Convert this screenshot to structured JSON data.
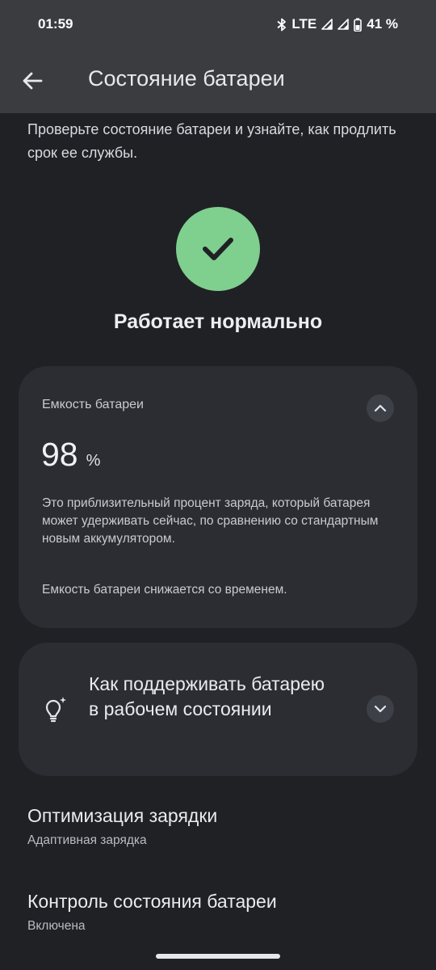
{
  "status_bar": {
    "time": "01:59",
    "network": "LTE",
    "battery_percent": "41 %"
  },
  "app_bar": {
    "title": "Состояние батареи"
  },
  "description": "Проверьте состояние батареи и узнайте, как продлить срок ее службы.",
  "health": {
    "status": "Работает нормально",
    "status_color": "#7fcf8f"
  },
  "capacity_card": {
    "label": "Емкость батареи",
    "value": "98",
    "unit": "%",
    "text": "Это приблизительный процент заряда, который батарея может удерживать сейчас, по сравнению со стандартным новым аккумулятором.",
    "note": "Емкость батареи снижается со временем.",
    "expanded": true
  },
  "tips_card": {
    "title": "Как поддерживать батарею в рабочем состоянии",
    "expanded": false
  },
  "settings": [
    {
      "title": "Оптимизация зарядки",
      "subtitle": "Адаптивная зарядка"
    },
    {
      "title": "Контроль состояния батареи",
      "subtitle": "Включена"
    }
  ]
}
